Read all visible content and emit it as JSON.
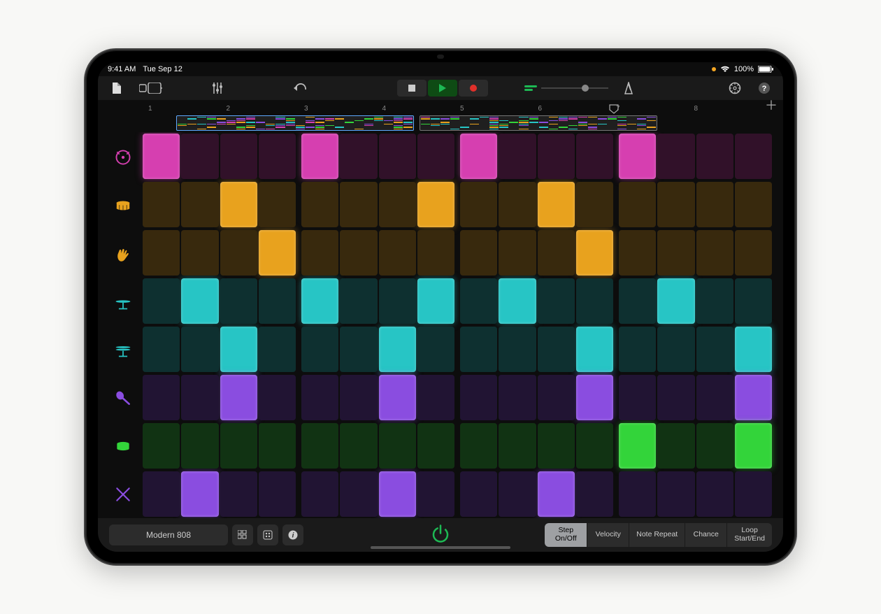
{
  "statusbar": {
    "time": "9:41 AM",
    "date": "Tue Sep 12",
    "battery": "100%"
  },
  "ruler": {
    "labels": [
      "1",
      "2",
      "3",
      "4",
      "5",
      "6",
      "7",
      "8"
    ]
  },
  "instruments": [
    {
      "name": "kick",
      "color": "#d63fb0"
    },
    {
      "name": "snare",
      "color": "#e8a21e"
    },
    {
      "name": "clap",
      "color": "#e8a21e"
    },
    {
      "name": "closed-hat",
      "color": "#27c5c5"
    },
    {
      "name": "open-hat",
      "color": "#27c5c5"
    },
    {
      "name": "shaker",
      "color": "#8a4de0"
    },
    {
      "name": "tom",
      "color": "#33d43a"
    },
    {
      "name": "sticks",
      "color": "#8a4de0"
    }
  ],
  "steps": 16,
  "pattern": [
    [
      1,
      0,
      0,
      0,
      1,
      0,
      0,
      0,
      1,
      0,
      0,
      0,
      1,
      0,
      0,
      0
    ],
    [
      0,
      0,
      1,
      0,
      0,
      0,
      0,
      1,
      0,
      0,
      1,
      0,
      0,
      0,
      0,
      0
    ],
    [
      0,
      0,
      0,
      1,
      0,
      0,
      0,
      0,
      0,
      0,
      0,
      1,
      0,
      0,
      0,
      0
    ],
    [
      0,
      1,
      0,
      0,
      1,
      0,
      0,
      1,
      0,
      1,
      0,
      0,
      0,
      1,
      0,
      0
    ],
    [
      0,
      0,
      1,
      0,
      0,
      0,
      1,
      0,
      0,
      0,
      0,
      1,
      0,
      0,
      0,
      1
    ],
    [
      0,
      0,
      1,
      0,
      0,
      0,
      1,
      0,
      0,
      0,
      0,
      1,
      0,
      0,
      0,
      1
    ],
    [
      0,
      0,
      0,
      0,
      0,
      0,
      0,
      0,
      0,
      0,
      0,
      0,
      1,
      0,
      0,
      1
    ],
    [
      0,
      1,
      0,
      0,
      0,
      0,
      1,
      0,
      0,
      0,
      1,
      0,
      0,
      0,
      0,
      0
    ]
  ],
  "bottombar": {
    "preset": "Modern 808",
    "modes": [
      "Step\nOn/Off",
      "Velocity",
      "Note Repeat",
      "Chance",
      "Loop\nStart/End"
    ],
    "active_mode": 0
  },
  "overview_colors": [
    "#d63fb0",
    "#e8a21e",
    "#27c5c5",
    "#8a4de0",
    "#33d43a",
    "#e8a21e",
    "#27c5c5",
    "#8a4de0"
  ]
}
